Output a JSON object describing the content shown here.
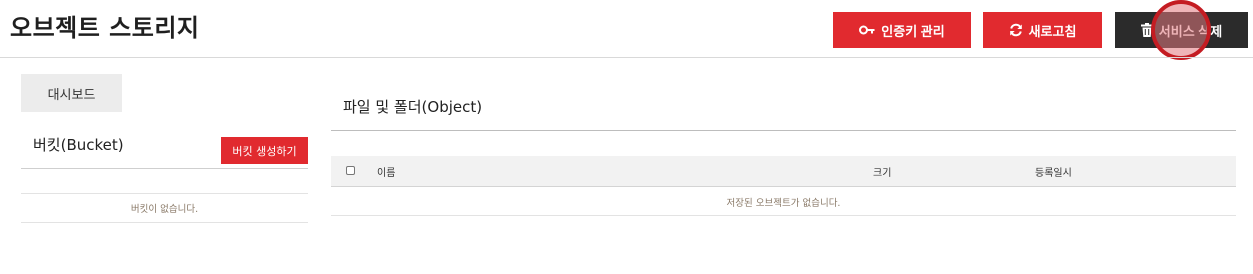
{
  "header": {
    "title": "오브젝트 스토리지",
    "key_button_label": "인증키 관리",
    "refresh_button_label": "새로고침",
    "delete_button_label": "서비스 삭제"
  },
  "sidebar": {
    "dashboard_label": "대시보드",
    "bucket_title": "버킷(Bucket)",
    "create_bucket_label": "버킷 생성하기",
    "empty_message": "버킷이 없습니다."
  },
  "main": {
    "title": "파일 및 폴더(Object)",
    "columns": [
      "이름",
      "크기",
      "등록일시"
    ],
    "empty_message": "저장된 오브젝트가 없습니다."
  },
  "icons": {
    "key": "key-icon",
    "refresh": "refresh-icon",
    "trash": "trash-icon",
    "checkbox": "select-all-checkbox"
  },
  "colors": {
    "accent_red": "#e12a2f",
    "dark_button": "#2b2b2b",
    "table_header_bg": "#f2f2f2"
  }
}
